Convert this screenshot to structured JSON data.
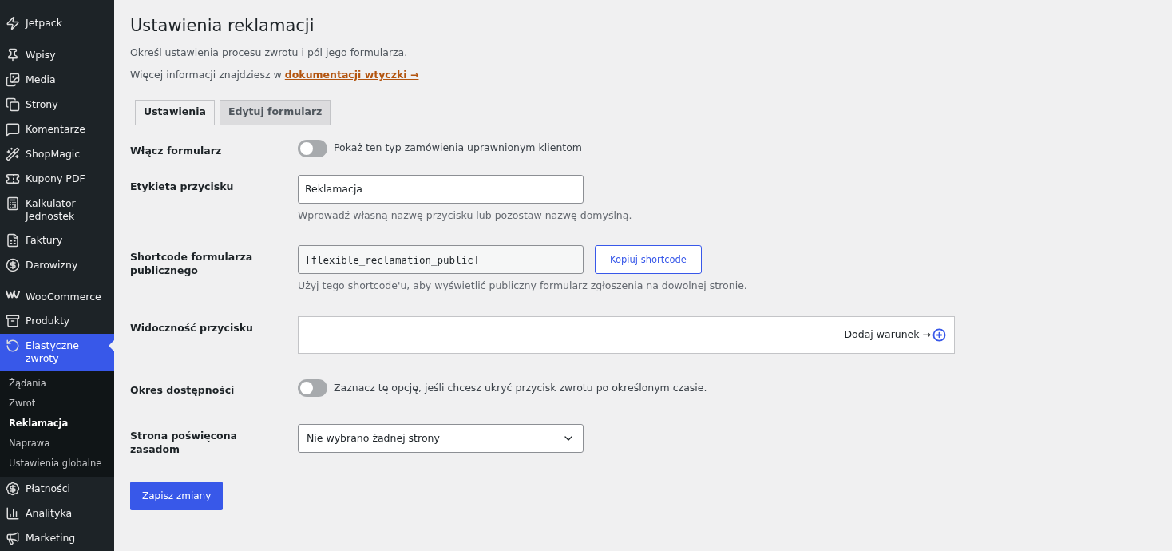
{
  "sidebar": {
    "groups": [
      [
        {
          "label": "Jetpack",
          "selected": false
        }
      ],
      [
        {
          "label": "Wpisy",
          "selected": false
        },
        {
          "label": "Media",
          "selected": false
        },
        {
          "label": "Strony",
          "selected": false
        },
        {
          "label": "Komentarze",
          "selected": false
        },
        {
          "label": "ShopMagic",
          "selected": false
        },
        {
          "label": "Kupony PDF",
          "selected": false
        },
        {
          "label": "Kalkulator Jednostek",
          "selected": false
        },
        {
          "label": "Faktury",
          "selected": false
        },
        {
          "label": "Darowizny",
          "selected": false
        }
      ],
      [
        {
          "label": "WooCommerce",
          "selected": false
        },
        {
          "label": "Produkty",
          "selected": false
        },
        {
          "label": "Elastyczne zwroty",
          "selected": true,
          "submenu": [
            {
              "label": "Żądania",
              "selected": false
            },
            {
              "label": "Zwrot",
              "selected": false
            },
            {
              "label": "Reklamacja",
              "selected": true
            },
            {
              "label": "Naprawa",
              "selected": false
            },
            {
              "label": "Ustawienia globalne",
              "selected": false
            }
          ]
        },
        {
          "label": "Płatności",
          "selected": false
        },
        {
          "label": "Analityka",
          "selected": false
        },
        {
          "label": "Marketing",
          "selected": false
        }
      ]
    ]
  },
  "page": {
    "title": "Ustawienia reklamacji",
    "description": "Określ ustawienia procesu zwrotu i pól jego formularza.",
    "more_info": "Więcej informacji znajdziesz w",
    "more_info_link": "dokumentacji wtyczki →"
  },
  "tabs": [
    {
      "label": "Ustawienia",
      "selected": true
    },
    {
      "label": "Edytuj formularz",
      "selected": false
    }
  ],
  "fields": [
    {
      "kind": "toggle",
      "label": "Włącz formularz",
      "on": false,
      "text": "Pokaż ten typ zamówienia uprawnionym klientom"
    },
    {
      "kind": "text",
      "label": "Etykieta przycisku",
      "value": "Reklamacja",
      "help": "Wprowadź własną nazwę przycisku lub pozostaw nazwę domyślną."
    },
    {
      "kind": "shortcode",
      "label": "Shortcode formularza publicznego",
      "value": "[flexible_reclamation_public]",
      "button": "Kopiuj shortcode",
      "help": "Użyj tego shortcode'u, aby wyświetlić publiczny formularz zgłoszenia na dowolnej stronie."
    },
    {
      "kind": "conditions",
      "label": "Widoczność przycisku",
      "action": "Dodaj warunek →"
    },
    {
      "kind": "toggle",
      "label": "Okres dostępności",
      "on": false,
      "text": "Zaznacz tę opcję, jeśli chcesz ukryć przycisk zwrotu po określonym czasie."
    },
    {
      "kind": "select",
      "label": "Strona poświęcona zasadom",
      "value": "Nie wybrano żadnej strony"
    }
  ],
  "save_button": "Zapisz zmiany"
}
